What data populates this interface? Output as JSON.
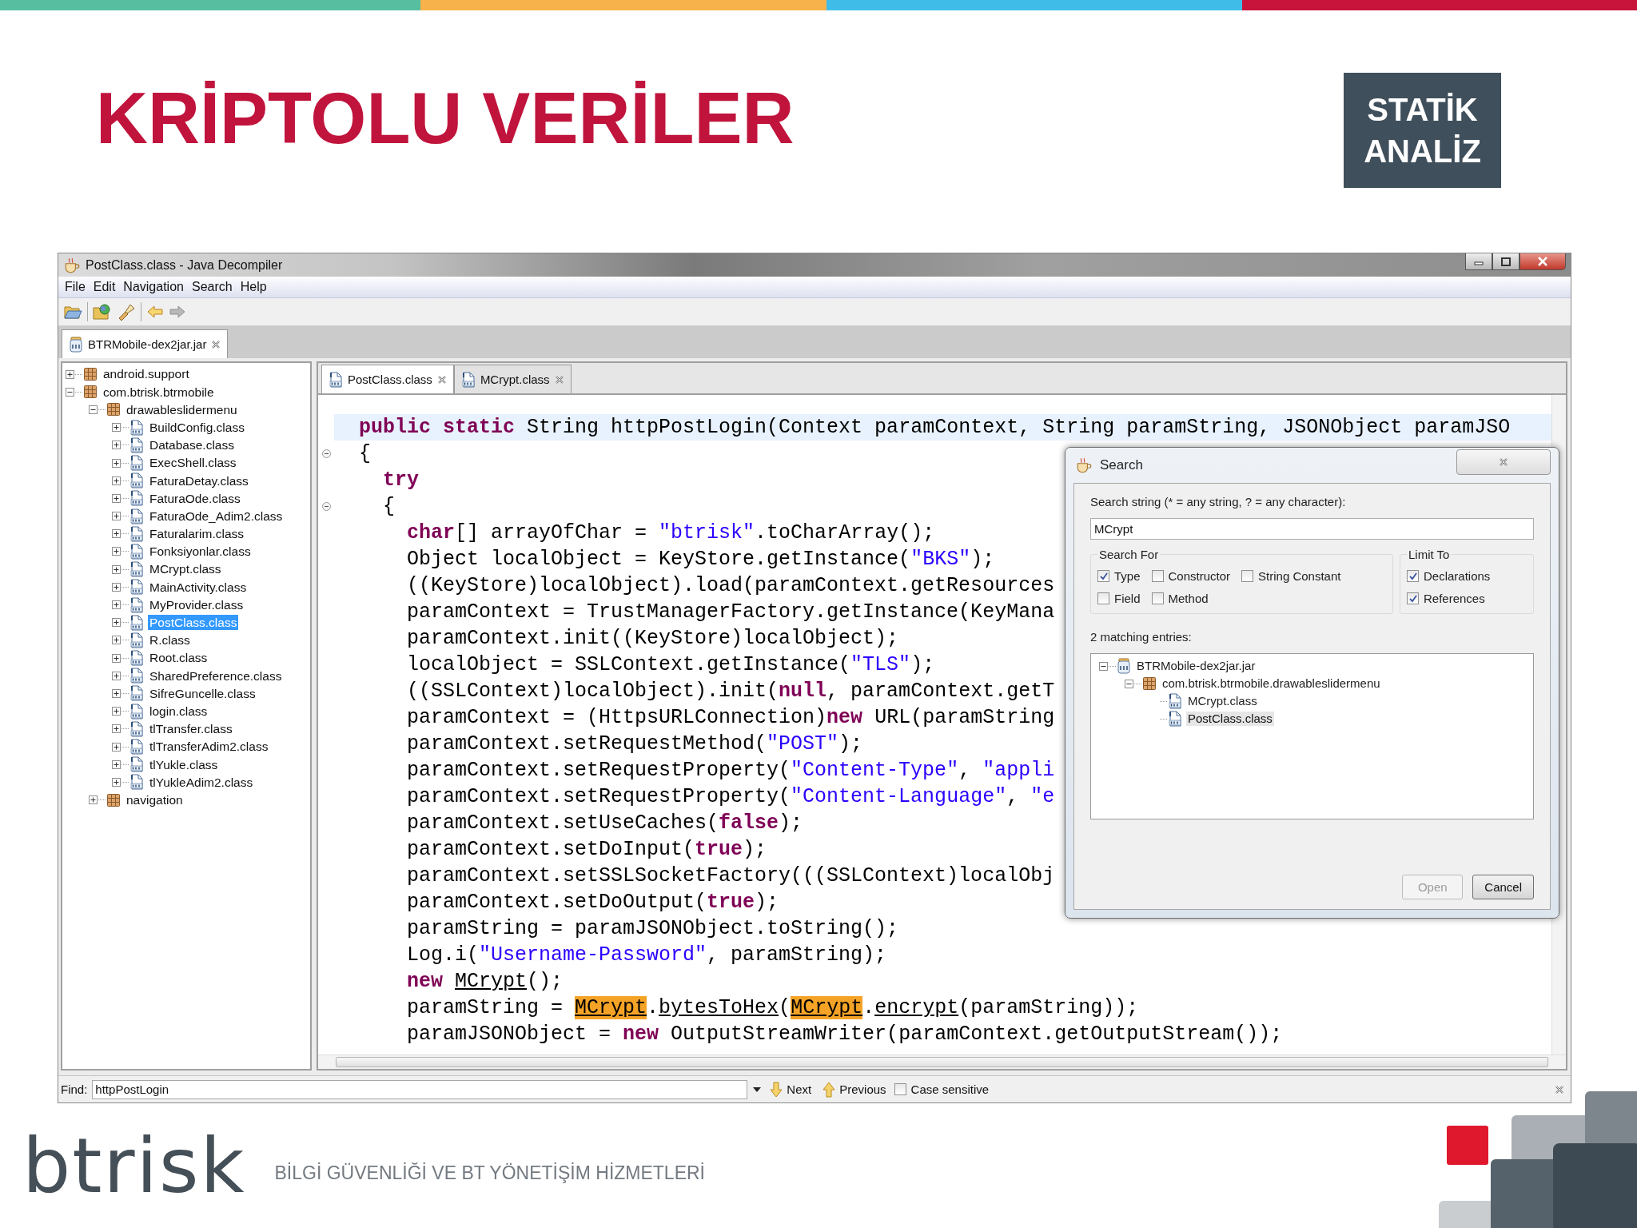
{
  "slide": {
    "title": "KRİPTOLU VERİLER",
    "badge": "STATİK ANALİZ"
  },
  "window": {
    "title": "PostClass.class - Java Decompiler"
  },
  "menu": [
    "File",
    "Edit",
    "Navigation",
    "Search",
    "Help"
  ],
  "toolbar": [
    {
      "kind": "open",
      "disabled": false
    },
    {
      "kind": "open-type",
      "disabled": false
    },
    {
      "kind": "search",
      "disabled": false
    },
    {
      "kind": "back",
      "disabled": false
    },
    {
      "kind": "forward",
      "disabled": true
    }
  ],
  "file_tabs": [
    {
      "label": "BTRMobile-dex2jar.jar",
      "selected": true
    }
  ],
  "tree": [
    {
      "label": "android.support",
      "kind": "package",
      "expanded": false,
      "selected": false
    },
    {
      "label": "com.btrisk.btrmobile",
      "kind": "package",
      "expanded": true,
      "selected": false,
      "children": [
        {
          "label": "drawableslidermenu",
          "kind": "package",
          "expanded": true,
          "selected": false,
          "children": [
            {
              "label": "BuildConfig.class",
              "kind": "class",
              "expanded": false,
              "selected": false
            },
            {
              "label": "Database.class",
              "kind": "class",
              "expanded": false,
              "selected": false
            },
            {
              "label": "ExecShell.class",
              "kind": "class",
              "expanded": false,
              "selected": false
            },
            {
              "label": "FaturaDetay.class",
              "kind": "class",
              "expanded": false,
              "selected": false
            },
            {
              "label": "FaturaOde.class",
              "kind": "class",
              "expanded": false,
              "selected": false
            },
            {
              "label": "FaturaOde_Adim2.class",
              "kind": "class",
              "expanded": false,
              "selected": false
            },
            {
              "label": "Faturalarim.class",
              "kind": "class",
              "expanded": false,
              "selected": false
            },
            {
              "label": "Fonksiyonlar.class",
              "kind": "class",
              "expanded": false,
              "selected": false
            },
            {
              "label": "MCrypt.class",
              "kind": "class",
              "expanded": false,
              "selected": false
            },
            {
              "label": "MainActivity.class",
              "kind": "class",
              "expanded": false,
              "selected": false
            },
            {
              "label": "MyProvider.class",
              "kind": "class",
              "expanded": false,
              "selected": false
            },
            {
              "label": "PostClass.class",
              "kind": "class",
              "expanded": false,
              "selected": true
            },
            {
              "label": "R.class",
              "kind": "class",
              "expanded": false,
              "selected": false
            },
            {
              "label": "Root.class",
              "kind": "class",
              "expanded": false,
              "selected": false
            },
            {
              "label": "SharedPreference.class",
              "kind": "class",
              "expanded": false,
              "selected": false
            },
            {
              "label": "SifreGuncelle.class",
              "kind": "class",
              "expanded": false,
              "selected": false
            },
            {
              "label": "login.class",
              "kind": "class",
              "expanded": false,
              "selected": false
            },
            {
              "label": "tlTransfer.class",
              "kind": "class",
              "expanded": false,
              "selected": false
            },
            {
              "label": "tlTransferAdim2.class",
              "kind": "class",
              "expanded": false,
              "selected": false
            },
            {
              "label": "tlYukle.class",
              "kind": "class",
              "expanded": false,
              "selected": false
            },
            {
              "label": "tlYukleAdim2.class",
              "kind": "class",
              "expanded": false,
              "selected": false
            }
          ]
        },
        {
          "label": "navigation",
          "kind": "package",
          "expanded": false,
          "selected": false
        }
      ]
    }
  ],
  "editor_tabs": [
    {
      "label": "PostClass.class",
      "selected": true
    },
    {
      "label": "MCrypt.class",
      "selected": false
    }
  ],
  "code": [
    {
      "current": true,
      "fold": false,
      "tokens": [
        {
          "kind": "keyword",
          "text": "public static"
        },
        {
          "kind": "plain",
          "text": " String httpPostLogin(Context paramContext, String paramString, JSONObject paramJSO"
        }
      ]
    },
    {
      "current": false,
      "fold": true,
      "tokens": [
        {
          "kind": "plain",
          "text": "{"
        }
      ]
    },
    {
      "current": false,
      "fold": false,
      "tokens": [
        {
          "kind": "keyword",
          "text": "  try"
        }
      ]
    },
    {
      "current": false,
      "fold": true,
      "tokens": [
        {
          "kind": "plain",
          "text": "  {"
        }
      ]
    },
    {
      "current": false,
      "fold": false,
      "tokens": [
        {
          "kind": "keyword",
          "text": "    char"
        },
        {
          "kind": "plain",
          "text": "[] arrayOfChar = "
        },
        {
          "kind": "string",
          "text": "\"btrisk\""
        },
        {
          "kind": "plain",
          "text": ".toCharArray();"
        }
      ]
    },
    {
      "current": false,
      "fold": false,
      "tokens": [
        {
          "kind": "plain",
          "text": "    Object localObject = KeyStore.getInstance("
        },
        {
          "kind": "string",
          "text": "\"BKS\""
        },
        {
          "kind": "plain",
          "text": ");"
        }
      ]
    },
    {
      "current": false,
      "fold": false,
      "tokens": [
        {
          "kind": "plain",
          "text": "    ((KeyStore)localObject).load(paramContext.getResources"
        }
      ]
    },
    {
      "current": false,
      "fold": false,
      "tokens": [
        {
          "kind": "plain",
          "text": "    paramContext = TrustManagerFactory.getInstance(KeyMana"
        }
      ]
    },
    {
      "current": false,
      "fold": false,
      "tokens": [
        {
          "kind": "plain",
          "text": "    paramContext.init((KeyStore)localObject);"
        }
      ]
    },
    {
      "current": false,
      "fold": false,
      "tokens": [
        {
          "kind": "plain",
          "text": "    localObject = SSLContext.getInstance("
        },
        {
          "kind": "string",
          "text": "\"TLS\""
        },
        {
          "kind": "plain",
          "text": ");"
        }
      ]
    },
    {
      "current": false,
      "fold": false,
      "tokens": [
        {
          "kind": "plain",
          "text": "    ((SSLContext)localObject).init("
        },
        {
          "kind": "keyword",
          "text": "null"
        },
        {
          "kind": "plain",
          "text": ", paramContext.getT"
        }
      ]
    },
    {
      "current": false,
      "fold": false,
      "tokens": [
        {
          "kind": "plain",
          "text": "    paramContext = (HttpsURLConnection)"
        },
        {
          "kind": "keyword",
          "text": "new"
        },
        {
          "kind": "plain",
          "text": " URL(paramString"
        }
      ]
    },
    {
      "current": false,
      "fold": false,
      "tokens": [
        {
          "kind": "plain",
          "text": "    paramContext.setRequestMethod("
        },
        {
          "kind": "string",
          "text": "\"POST\""
        },
        {
          "kind": "plain",
          "text": ");"
        }
      ]
    },
    {
      "current": false,
      "fold": false,
      "tokens": [
        {
          "kind": "plain",
          "text": "    paramContext.setRequestProperty("
        },
        {
          "kind": "string",
          "text": "\"Content-Type\""
        },
        {
          "kind": "plain",
          "text": ", "
        },
        {
          "kind": "string",
          "text": "\"appli"
        }
      ]
    },
    {
      "current": false,
      "fold": false,
      "tokens": [
        {
          "kind": "plain",
          "text": "    paramContext.setRequestProperty("
        },
        {
          "kind": "string",
          "text": "\"Content-Language\""
        },
        {
          "kind": "plain",
          "text": ", "
        },
        {
          "kind": "string",
          "text": "\"e"
        }
      ]
    },
    {
      "current": false,
      "fold": false,
      "tokens": [
        {
          "kind": "plain",
          "text": "    paramContext.setUseCaches("
        },
        {
          "kind": "keyword",
          "text": "false"
        },
        {
          "kind": "plain",
          "text": ");"
        }
      ]
    },
    {
      "current": false,
      "fold": false,
      "tokens": [
        {
          "kind": "plain",
          "text": "    paramContext.setDoInput("
        },
        {
          "kind": "keyword",
          "text": "true"
        },
        {
          "kind": "plain",
          "text": ");"
        }
      ]
    },
    {
      "current": false,
      "fold": false,
      "tokens": [
        {
          "kind": "plain",
          "text": "    paramContext.setSSLSocketFactory(((SSLContext)localObj"
        }
      ]
    },
    {
      "current": false,
      "fold": false,
      "tokens": [
        {
          "kind": "plain",
          "text": "    paramContext.setDoOutput("
        },
        {
          "kind": "keyword",
          "text": "true"
        },
        {
          "kind": "plain",
          "text": ");"
        }
      ]
    },
    {
      "current": false,
      "fold": false,
      "tokens": [
        {
          "kind": "plain",
          "text": "    paramString = paramJSONObject.toString();"
        }
      ]
    },
    {
      "current": false,
      "fold": false,
      "tokens": [
        {
          "kind": "plain",
          "text": "    Log.i("
        },
        {
          "kind": "string",
          "text": "\"Username-Password\""
        },
        {
          "kind": "plain",
          "text": ", paramString);"
        }
      ]
    },
    {
      "current": false,
      "fold": false,
      "tokens": [
        {
          "kind": "keyword",
          "text": "    new "
        },
        {
          "kind": "reference",
          "text": "MCrypt"
        },
        {
          "kind": "plain",
          "text": "();"
        }
      ]
    },
    {
      "current": false,
      "fold": false,
      "tokens": [
        {
          "kind": "plain",
          "text": "    paramString = "
        },
        {
          "kind": "match",
          "text": "MCrypt"
        },
        {
          "kind": "plain",
          "text": "."
        },
        {
          "kind": "reference",
          "text": "bytesToHex"
        },
        {
          "kind": "plain",
          "text": "("
        },
        {
          "kind": "match",
          "text": "MCrypt"
        },
        {
          "kind": "plain",
          "text": "."
        },
        {
          "kind": "reference",
          "text": "encrypt"
        },
        {
          "kind": "plain",
          "text": "(paramString));"
        }
      ]
    },
    {
      "current": false,
      "fold": false,
      "tokens": [
        {
          "kind": "plain",
          "text": "    paramJSONObject = "
        },
        {
          "kind": "keyword",
          "text": "new"
        },
        {
          "kind": "plain",
          "text": " OutputStreamWriter(paramContext.getOutputStream());"
        }
      ]
    }
  ],
  "search_dialog": {
    "title": "Search",
    "prompt": "Search string (* = any string, ? = any character):",
    "value": "MCrypt",
    "search_for": {
      "label": "Search For",
      "options": [
        {
          "label": "Type",
          "checked": true
        },
        {
          "label": "Constructor",
          "checked": false
        },
        {
          "label": "String Constant",
          "checked": false
        },
        {
          "label": "Field",
          "checked": false
        },
        {
          "label": "Method",
          "checked": false
        }
      ]
    },
    "limit_to": {
      "label": "Limit To",
      "options": [
        {
          "label": "Declarations",
          "checked": true
        },
        {
          "label": "References",
          "checked": true
        }
      ]
    },
    "results_label": "2 matching entries:",
    "results": [
      {
        "label": "BTRMobile-dex2jar.jar",
        "kind": "jar",
        "expanded": true,
        "selected": false,
        "children": [
          {
            "label": "com.btrisk.btrmobile.drawableslidermenu",
            "kind": "package",
            "expanded": true,
            "selected": false,
            "children": [
              {
                "label": "MCrypt.class",
                "kind": "class",
                "selected": false
              },
              {
                "label": "PostClass.class",
                "kind": "class",
                "selected": true
              }
            ]
          }
        ]
      }
    ],
    "buttons": [
      {
        "label": "Open",
        "disabled": true
      },
      {
        "label": "Cancel",
        "disabled": false
      }
    ]
  },
  "find_bar": {
    "label": "Find:",
    "value": "httpPostLogin",
    "next": "Next",
    "previous": "Previous",
    "case_sensitive": {
      "label": "Case sensitive",
      "checked": false
    }
  },
  "footer": {
    "logo": "btrisk",
    "tagline": "BİLGİ GÜVENLİĞİ VE BT YÖNETİŞİM HİZMETLERİ"
  }
}
